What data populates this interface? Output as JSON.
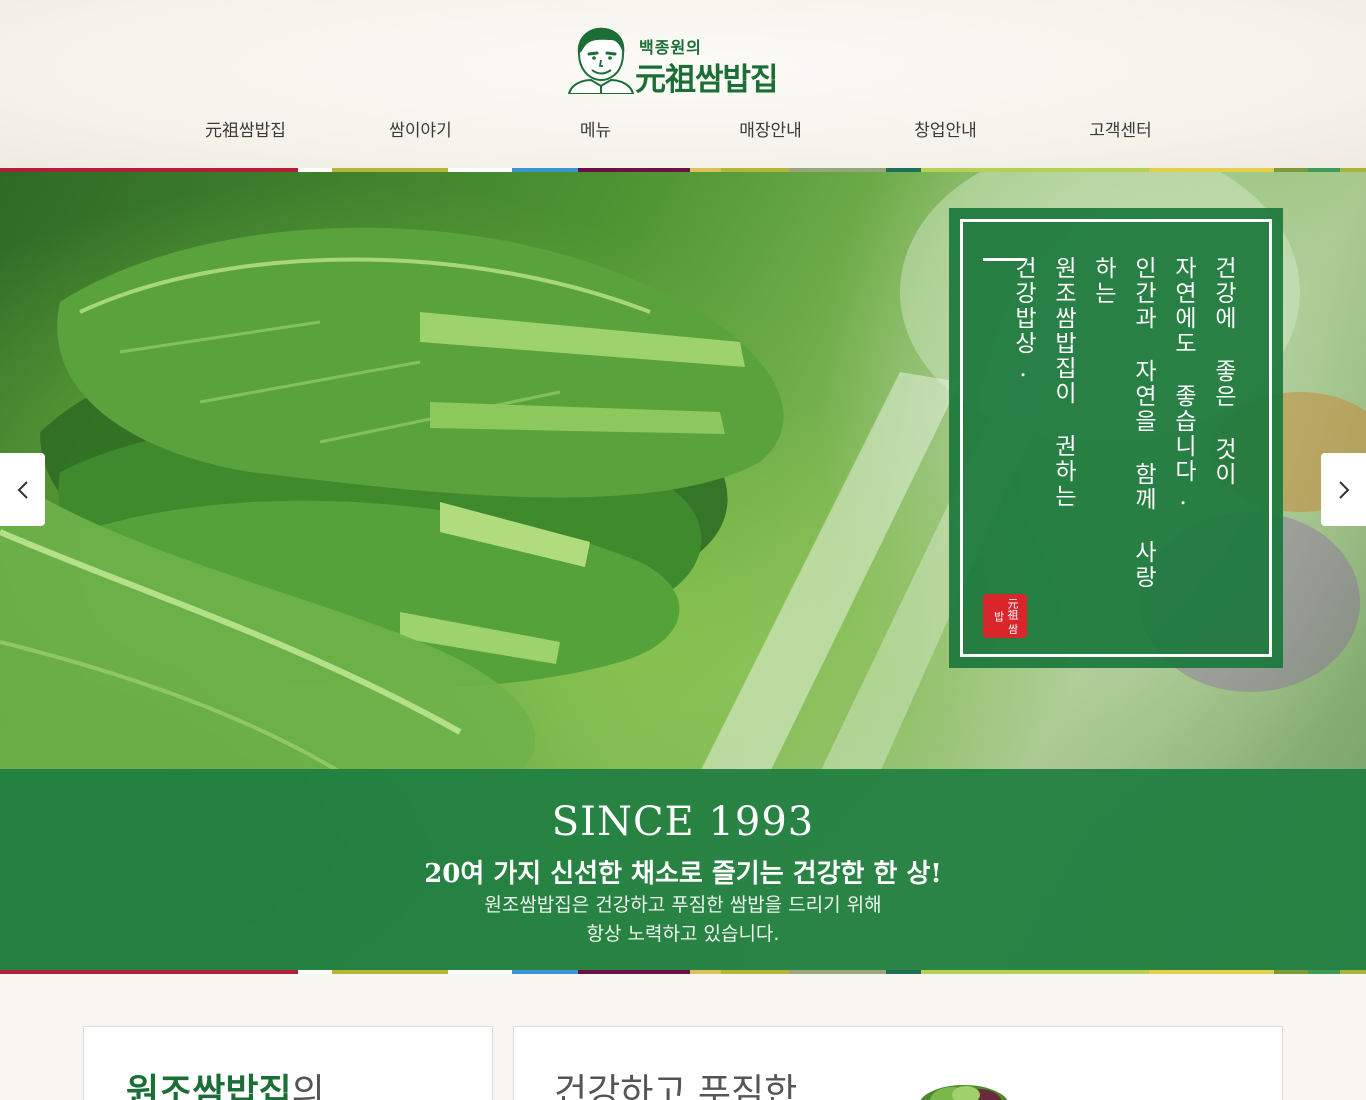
{
  "brand": {
    "subtitle": "백종원의",
    "name": "元祖쌈밥집"
  },
  "nav": {
    "items": [
      "元祖쌈밥집",
      "쌈이야기",
      "메뉴",
      "매장안내",
      "창업안내",
      "고객센터"
    ]
  },
  "colors": {
    "brand_green": "#1a6e36",
    "band_green": "#228042",
    "strip": [
      "#b21e3a",
      "#ffffff",
      "#b7b43a",
      "#ffffff",
      "#3b95d1",
      "#6a1245",
      "#d9c25a",
      "#b7b43a",
      "#9aa57c",
      "#1f6e5a",
      "#b7cf55",
      "#e2d04a",
      "#7c9a3a",
      "#3f9a57",
      "#a8b53a"
    ]
  },
  "hero": {
    "quote_lines": [
      "건강에 좋은 것이",
      "자연에도 좋습니다.",
      "인간과 자연을 함께 사랑하는",
      "원조쌈밥집이 권하는",
      "건강밥상."
    ],
    "seal_text": "元祖 쌈밥",
    "since": "SINCE 1993",
    "headline": "20여 가지 신선한 채소로 즐기는 건강한 한 상!",
    "desc_lines": [
      "원조쌈밥집은 건강하고 푸짐한 쌈밥을 드리기 위해",
      "항상 노력하고 있습니다."
    ],
    "prev_icon": "chevron-left-icon",
    "next_icon": "chevron-right-icon"
  },
  "cards": {
    "left_title_strong": "원조쌈밥집",
    "left_title_weak": "의",
    "right_title": "건강하고 푸짐한"
  }
}
